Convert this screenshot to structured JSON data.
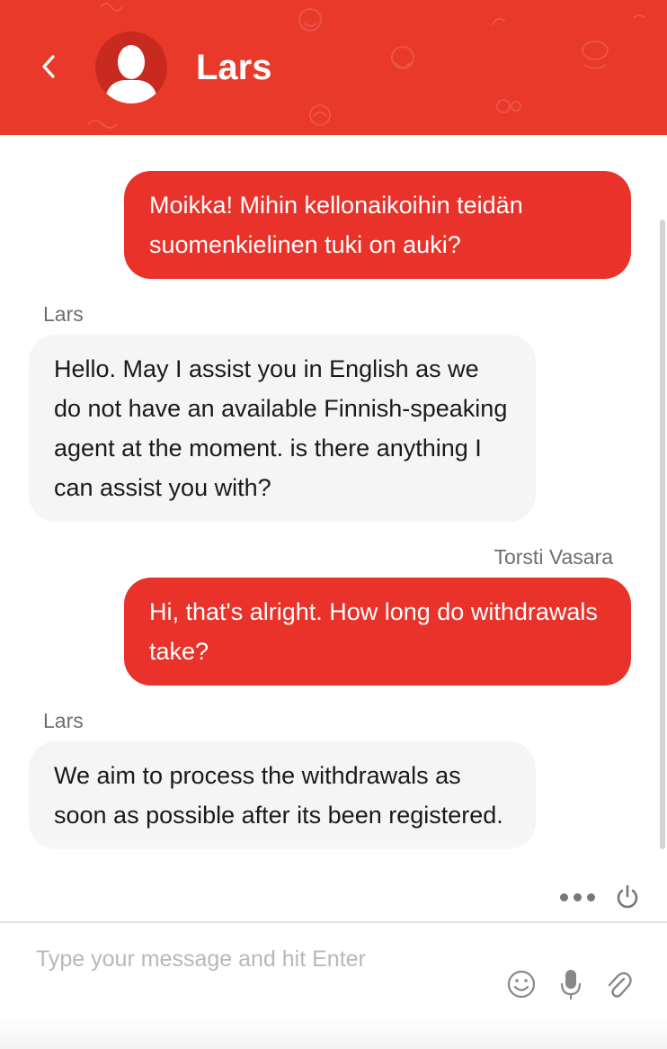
{
  "header": {
    "contact_name": "Lars",
    "bg_color": "#e8392b",
    "back_icon": "chevron-left-icon",
    "avatar_icon": "user-silhouette-icon"
  },
  "messages": [
    {
      "direction": "outgoing",
      "sender": "",
      "text": "Moikka! Mihin kellonaikoihin teidän suomenkielinen tuki on auki?"
    },
    {
      "direction": "incoming",
      "sender": "Lars",
      "text": "Hello. May I assist you in English as we do not have an available Finnish-speaking agent at the moment. is there anything I can assist you with?"
    },
    {
      "direction": "outgoing",
      "sender": "Torsti Vasara",
      "text": "Hi, that's alright. How long do withdrawals take?"
    },
    {
      "direction": "incoming",
      "sender": "Lars",
      "text": "We aim to process the withdrawals as soon as possible after its been registered."
    }
  ],
  "toolbar": {
    "more_icon": "more-dots-icon",
    "power_icon": "power-icon"
  },
  "composer": {
    "placeholder": "Type your message and hit Enter",
    "value": "",
    "emoji_icon": "emoji-icon",
    "mic_icon": "microphone-icon",
    "attach_icon": "paperclip-icon"
  },
  "colors": {
    "outgoing_bubble": "#e8322a",
    "incoming_bubble": "#f5f5f5",
    "sender_label": "#6e6e6e"
  }
}
